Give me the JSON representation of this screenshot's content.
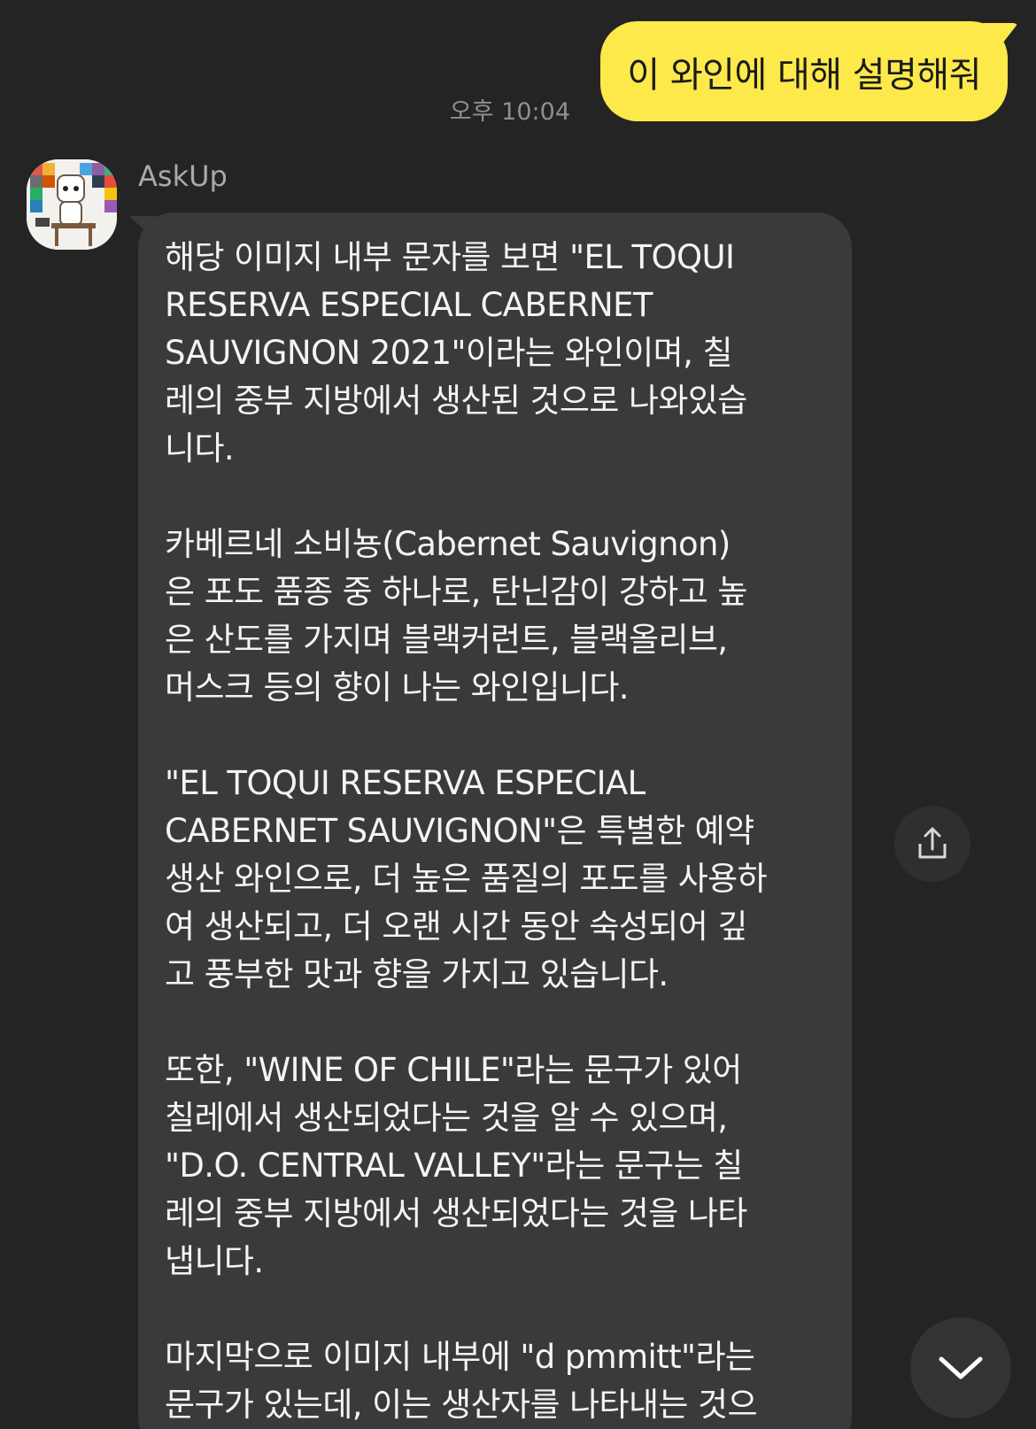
{
  "outgoing": {
    "text": "이 와인에 대해 설명해줘",
    "time": "오후 10:04"
  },
  "incoming": {
    "sender": "AskUp",
    "paragraphs": [
      "해당 이미지 내부 문자를 보면 \"EL TOQUI\nRESERVA ESPECIAL CABERNET\nSAUVIGNON 2021\"이라는 와인이며, 칠\n레의 중부 지방에서 생산된 것으로 나와있습\n니다.",
      "카베르네 소비뇽(Cabernet Sauvignon)\n은 포도 품종 중 하나로, 탄닌감이 강하고 높\n은 산도를 가지며 블랙커런트, 블랙올리브,\n머스크 등의 향이 나는 와인입니다.",
      "\"EL TOQUI RESERVA ESPECIAL\nCABERNET SAUVIGNON\"은 특별한 예약\n생산 와인으로, 더 높은 품질의 포도를 사용하\n여 생산되고, 더 오랜 시간 동안 숙성되어 깊\n고 풍부한 맛과 향을 가지고 있습니다.",
      "또한, \"WINE OF CHILE\"라는 문구가 있어\n칠레에서 생산되었다는 것을 알 수 있으며,\n\"D.O. CENTRAL VALLEY\"라는 문구는 칠\n레의 중부 지방에서 생산되었다는 것을 나타\n냅니다.",
      "마지막으로 이미지 내부에 \"d pmmitt\"라는\n문구가 있는데, 이는 생산자를 나타내는 것으"
    ]
  },
  "icons": {
    "share": "share-icon",
    "scroll_down": "chevron-down-icon",
    "avatar": "robot-avatar-icon"
  },
  "colors": {
    "background": "#242424",
    "my_bubble": "#fee94a",
    "bot_bubble": "#3a3a3c"
  }
}
